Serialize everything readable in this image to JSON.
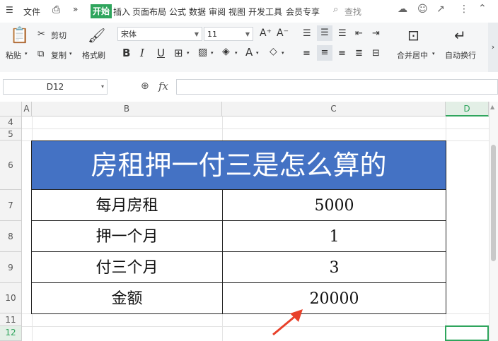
{
  "menubar": {
    "file": "文件",
    "tabs": [
      "开始",
      "插入",
      "页面布局",
      "公式",
      "数据",
      "审阅",
      "视图",
      "开发工具",
      "会员专享"
    ],
    "search": "查找"
  },
  "ribbon": {
    "paste": "粘贴",
    "cut": "剪切",
    "copy": "复制",
    "format_painter": "格式刷",
    "font_name": "宋体",
    "font_size": "11",
    "merge_center": "合并居中",
    "wrap_text": "自动换行"
  },
  "formula_bar": {
    "name_box": "D12",
    "fx": "fx"
  },
  "columns": [
    "A",
    "B",
    "C",
    "D"
  ],
  "rows": [
    "4",
    "5",
    "6",
    "7",
    "8",
    "9",
    "10",
    "11",
    "12"
  ],
  "table": {
    "title": "房租押一付三是怎么算的",
    "rows": [
      {
        "label": "每月房租",
        "value": "5000"
      },
      {
        "label": "押一个月",
        "value": "1"
      },
      {
        "label": "付三个月",
        "value": "3"
      },
      {
        "label": "金额",
        "value": "20000"
      }
    ]
  },
  "colors": {
    "accent": "#2fa55d",
    "title_fill": "#4472c4",
    "arrow": "#e8402a"
  }
}
